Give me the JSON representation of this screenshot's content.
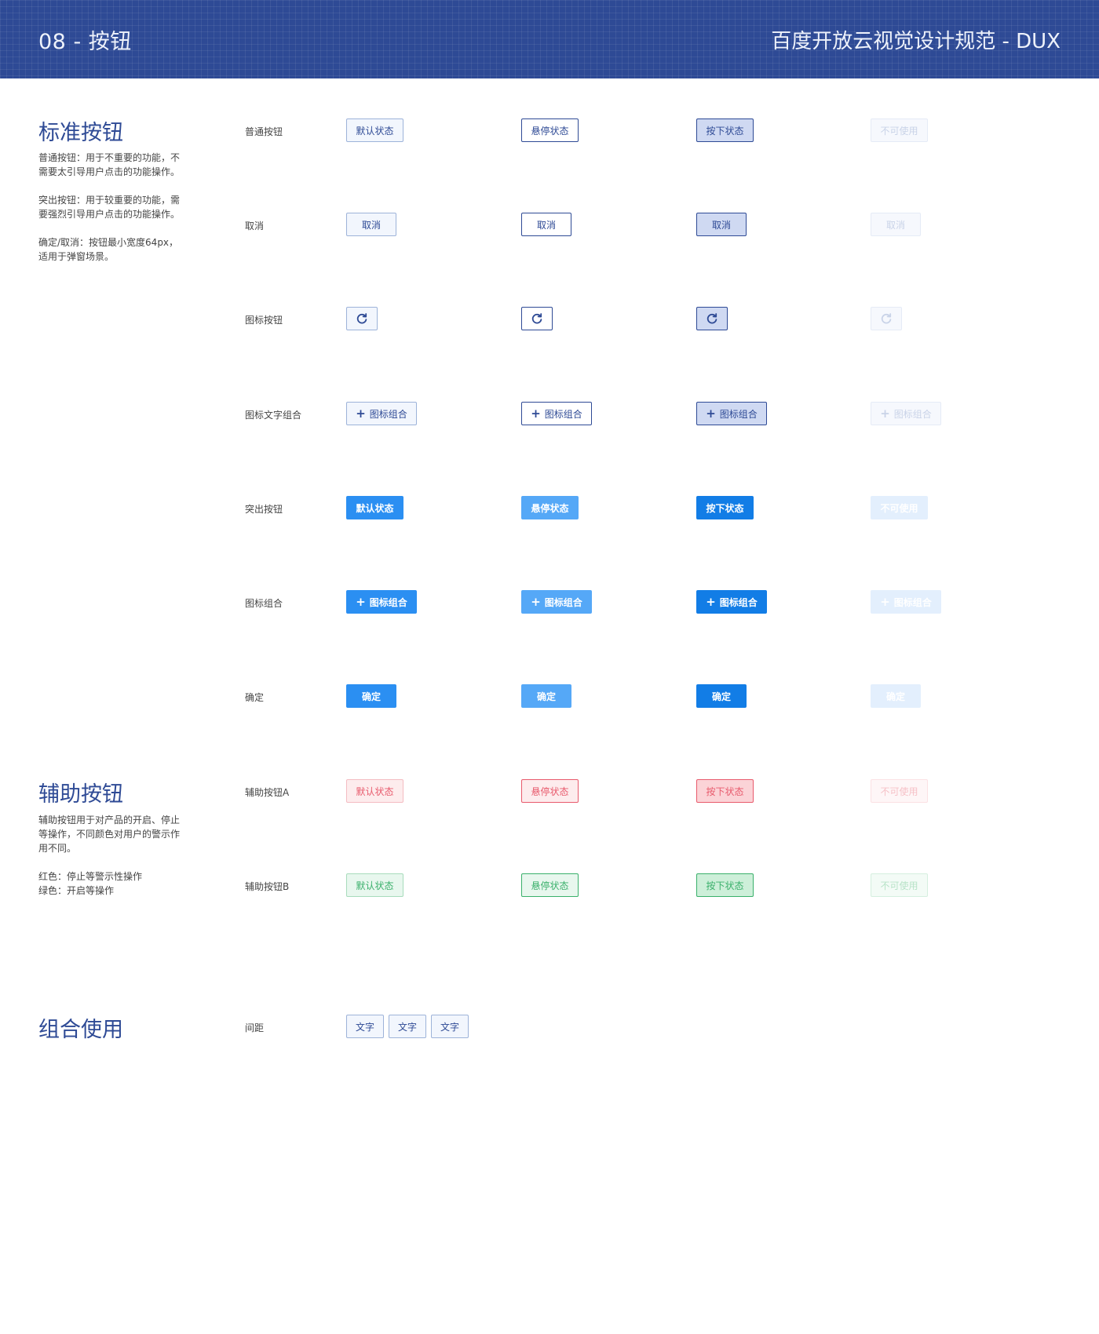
{
  "header": {
    "left_title": "08 - 按钮",
    "right_title": "百度开放云视觉设计规范 - DUX"
  },
  "sections": {
    "standard": {
      "title": "标准按钮",
      "desc": [
        "普通按钮：用于不重要的功能，不需要太引导用户点击的功能操作。",
        "突出按钮：用于较重要的功能，需要强烈引导用户点击的功能操作。",
        "确定/取消：按钮最小宽度64px，适用于弹窗场景。"
      ]
    },
    "auxiliary": {
      "title": "辅助按钮",
      "desc": [
        "辅助按钮用于对产品的开启、停止等操作，不同颜色对用户的警示作用不同。",
        "红色：停止等警示性操作\n绿色：开启等操作"
      ]
    },
    "combo": {
      "title": "组合使用"
    }
  },
  "rows": [
    {
      "label": "普通按钮",
      "buttons": [
        {
          "text": "默认状态",
          "state": "default"
        },
        {
          "text": "悬停状态",
          "state": "hover"
        },
        {
          "text": "按下状态",
          "state": "pressed"
        },
        {
          "text": "不可使用",
          "state": "disabled"
        }
      ]
    },
    {
      "label": "取消",
      "buttons": [
        {
          "text": "取消",
          "state": "default"
        },
        {
          "text": "取消",
          "state": "hover"
        },
        {
          "text": "取消",
          "state": "pressed"
        },
        {
          "text": "取消",
          "state": "disabled"
        }
      ]
    },
    {
      "label": "图标按钮",
      "buttons": [
        {
          "icon": "refresh-icon",
          "state": "default"
        },
        {
          "icon": "refresh-icon",
          "state": "hover"
        },
        {
          "icon": "refresh-icon",
          "state": "pressed"
        },
        {
          "icon": "refresh-icon",
          "state": "disabled"
        }
      ]
    },
    {
      "label": "图标文字组合",
      "buttons": [
        {
          "icon": "plus-icon",
          "text": "图标组合",
          "state": "default"
        },
        {
          "icon": "plus-icon",
          "text": "图标组合",
          "state": "hover"
        },
        {
          "icon": "plus-icon",
          "text": "图标组合",
          "state": "pressed"
        },
        {
          "icon": "plus-icon",
          "text": "图标组合",
          "state": "disabled"
        }
      ]
    },
    {
      "label": "突出按钮",
      "buttons": [
        {
          "text": "默认状态",
          "state": "default"
        },
        {
          "text": "悬停状态",
          "state": "hover"
        },
        {
          "text": "按下状态",
          "state": "pressed"
        },
        {
          "text": "不可使用",
          "state": "disabled"
        }
      ]
    },
    {
      "label": "图标组合",
      "buttons": [
        {
          "icon": "plus-icon",
          "text": "图标组合",
          "state": "default"
        },
        {
          "icon": "plus-icon",
          "text": "图标组合",
          "state": "hover"
        },
        {
          "icon": "plus-icon",
          "text": "图标组合",
          "state": "pressed"
        },
        {
          "icon": "plus-icon",
          "text": "图标组合",
          "state": "disabled"
        }
      ]
    },
    {
      "label": "确定",
      "buttons": [
        {
          "text": "确定",
          "state": "default"
        },
        {
          "text": "确定",
          "state": "hover"
        },
        {
          "text": "确定",
          "state": "pressed"
        },
        {
          "text": "确定",
          "state": "disabled"
        }
      ]
    },
    {
      "label": "辅助按钮A",
      "buttons": [
        {
          "text": "默认状态",
          "state": "default"
        },
        {
          "text": "悬停状态",
          "state": "hover"
        },
        {
          "text": "按下状态",
          "state": "pressed"
        },
        {
          "text": "不可使用",
          "state": "disabled"
        }
      ]
    },
    {
      "label": "辅助按钮B",
      "buttons": [
        {
          "text": "默认状态",
          "state": "default"
        },
        {
          "text": "悬停状态",
          "state": "hover"
        },
        {
          "text": "按下状态",
          "state": "pressed"
        },
        {
          "text": "不可使用",
          "state": "disabled"
        }
      ]
    },
    {
      "label": "间距",
      "buttons": [
        {
          "text": "文字",
          "state": "default"
        },
        {
          "text": "文字",
          "state": "default"
        },
        {
          "text": "文字",
          "state": "default"
        }
      ]
    }
  ],
  "colors": {
    "header_bg": "#2e4a95",
    "title": "#2e4a95",
    "primary": "#2b8ff2",
    "primary_hover": "#55a8f7",
    "primary_pressed": "#127de6",
    "danger_text": "#e85a6c",
    "success_text": "#3ab06b"
  }
}
